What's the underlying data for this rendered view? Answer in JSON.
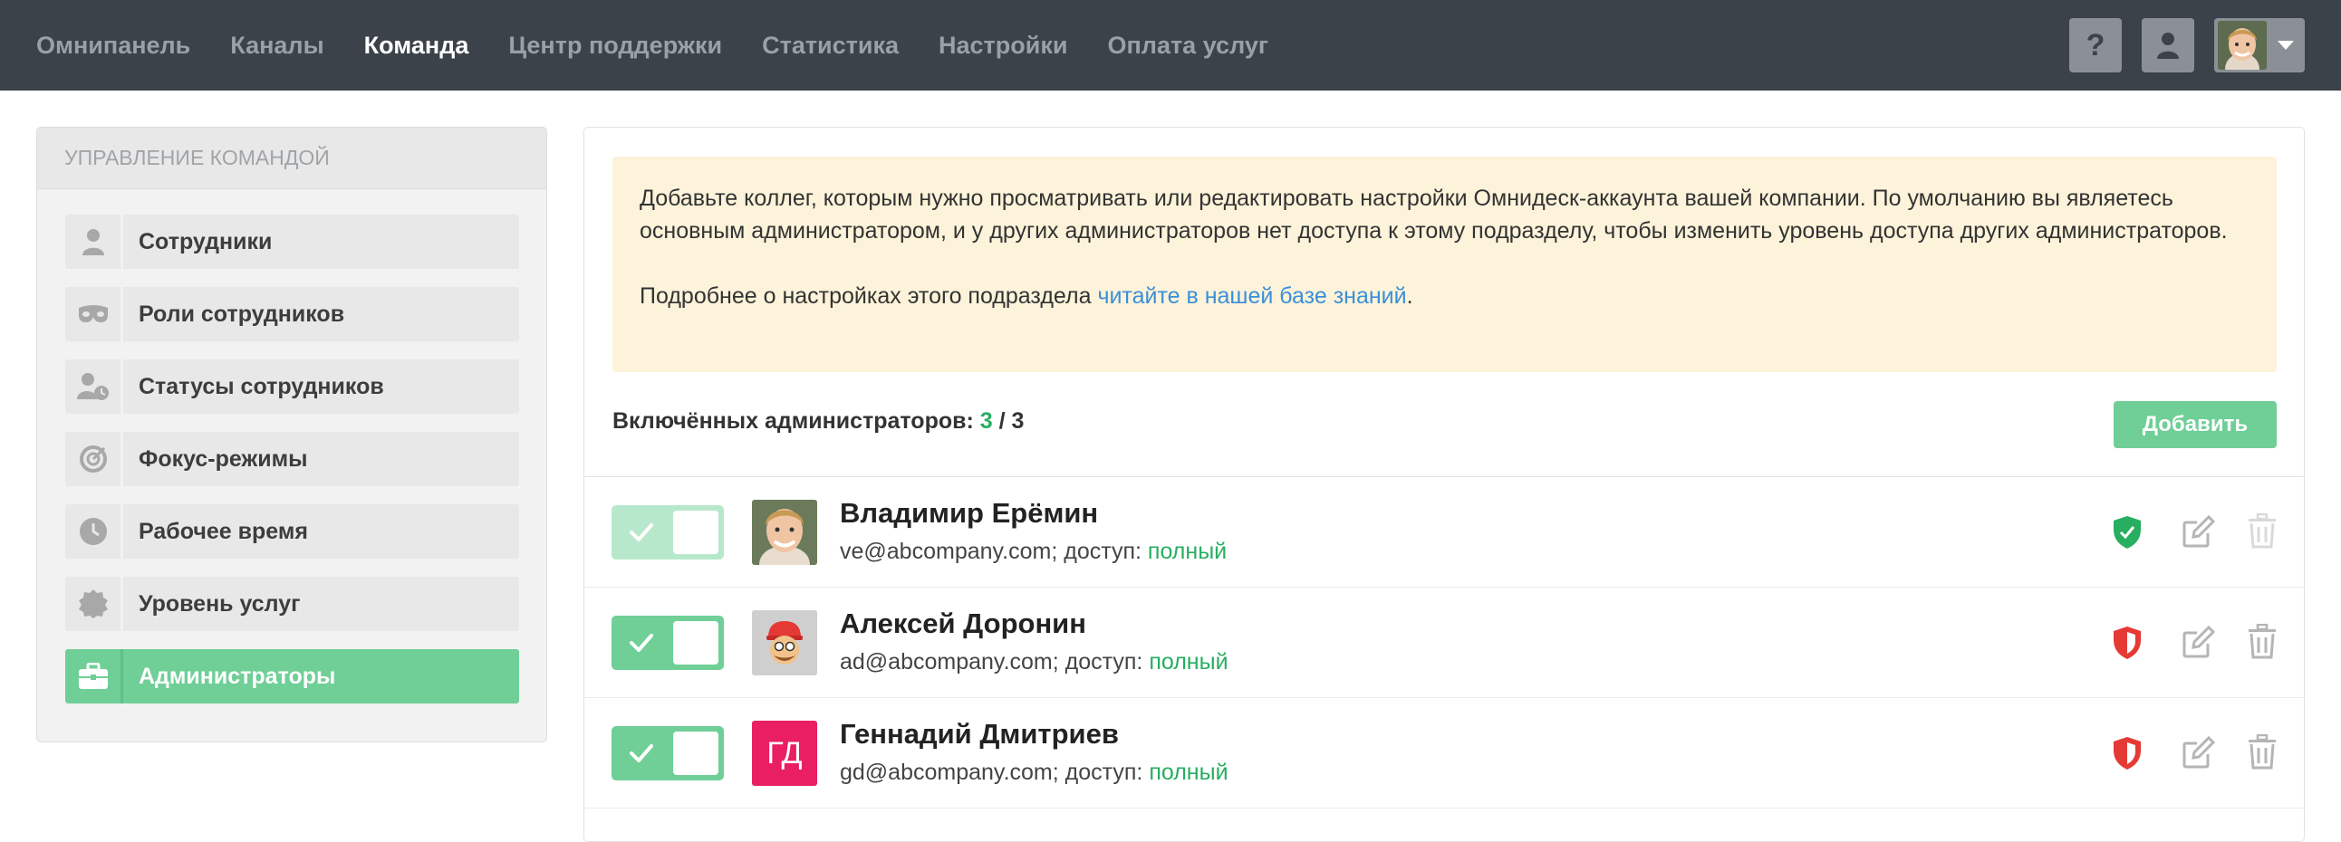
{
  "topnav": {
    "items": [
      "Омнипанель",
      "Каналы",
      "Команда",
      "Центр поддержки",
      "Статистика",
      "Настройки",
      "Оплата услуг"
    ],
    "active": "Команда",
    "help_label": "?"
  },
  "sidebar": {
    "title": "Управление командой",
    "items": [
      {
        "label": "Сотрудники",
        "icon": "user-icon"
      },
      {
        "label": "Роли сотрудников",
        "icon": "mask-icon"
      },
      {
        "label": "Статусы сотрудников",
        "icon": "user-clock-icon"
      },
      {
        "label": "Фокус-режимы",
        "icon": "target-icon"
      },
      {
        "label": "Рабочее время",
        "icon": "clock-icon"
      },
      {
        "label": "Уровень услуг",
        "icon": "badge-icon"
      },
      {
        "label": "Администраторы",
        "icon": "briefcase-icon",
        "active": true
      }
    ]
  },
  "notice": {
    "text1": "Добавьте коллег, которым нужно просматривать или редактировать настройки Омнидеск-аккаунта вашей компании. По умолчанию вы являетесь основным администратором, и у других администраторов нет доступа к этому подразделу, чтобы изменить уровень доступа других администраторов.",
    "text2_prefix": "Подробнее о настройках этого подраздела ",
    "text2_link": "читайте в нашей базе знаний",
    "text2_suffix": "."
  },
  "admins_count": {
    "label": "Включённых администраторов:",
    "enabled": "3",
    "separator": "/",
    "total": "3"
  },
  "add_button": "Добавить",
  "admins": [
    {
      "name": "Владимир Ерёмин",
      "email": "ve@abcompany.com; доступ:",
      "access": "полный",
      "enabled": true,
      "toggle_faded": true,
      "shield_color": "#27ae60",
      "avatar": "photo"
    },
    {
      "name": "Алексей Доронин",
      "email": "ad@abcompany.com; доступ:",
      "access": "полный",
      "enabled": true,
      "toggle_faded": false,
      "shield_color": "#e53935",
      "avatar": "emoji"
    },
    {
      "name": "Геннадий Дмитриев",
      "email": "gd@abcompany.com; доступ:",
      "access": "полный",
      "enabled": true,
      "toggle_faded": false,
      "shield_color": "#e53935",
      "avatar": "initials",
      "initials": "ГД"
    }
  ],
  "colors": {
    "topbar": "#3b4249",
    "accent_green": "#6fcf97",
    "status_green": "#27ae60",
    "danger_red": "#e53935",
    "notice_bg": "#fcf3da",
    "link_blue": "#3b8fd9"
  }
}
